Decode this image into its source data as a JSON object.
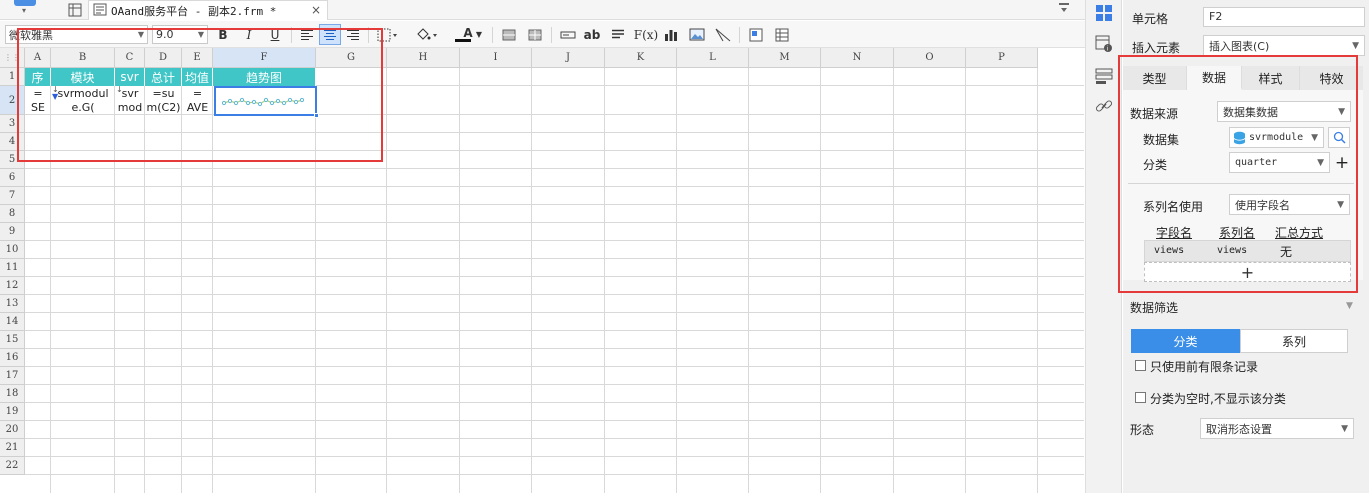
{
  "tabbar": {
    "doc_tab_title": "OAand服务平台 - 副本2.frm *",
    "close_glyph": "×",
    "menu_glyph": "▾"
  },
  "toolbar": {
    "font_family": "微软雅黑",
    "font_size": "9.0",
    "bold": "B",
    "italic": "I",
    "underline": "U",
    "ab_label": "ab",
    "fx_label": "F(x)",
    "font_color": "A"
  },
  "grid": {
    "corner_glyph": "⋮⋮",
    "columns": [
      "A",
      "B",
      "C",
      "D",
      "E",
      "F",
      "G",
      "H",
      "I",
      "J",
      "K",
      "L",
      "M",
      "N",
      "O",
      "P"
    ],
    "rows": [
      "1",
      "2",
      "3",
      "4",
      "5",
      "6",
      "7",
      "8",
      "9",
      "10",
      "11",
      "12",
      "13",
      "14",
      "15",
      "16",
      "17",
      "18",
      "19",
      "20",
      "21",
      "22"
    ],
    "header_row": [
      "序",
      "模块",
      "svr",
      "总计",
      "均值",
      "趋势图"
    ],
    "data_row": [
      "=\nSE",
      "svrmodul\ne.G(",
      "svr\nmod",
      "=su\nm(C2)",
      "=\nAVE",
      ""
    ],
    "selected_cell": "F2",
    "accent": "#40c6c6"
  },
  "panel": {
    "cell_label": "单元格",
    "cell_value": "F2",
    "insert_label": "插入元素",
    "insert_value": "插入图表(C)",
    "tabs": [
      "类型",
      "数据",
      "样式",
      "特效"
    ],
    "active_tab": "数据",
    "source_label": "数据来源",
    "source_value": "数据集数据",
    "dataset_label": "数据集",
    "dataset_value": "svrmodule",
    "category_label": "分类",
    "category_value": "quarter",
    "series_name_label": "系列名使用",
    "series_name_value": "使用字段名",
    "field_headers": [
      "字段名",
      "系列名",
      "汇总方式"
    ],
    "field_row": [
      "views",
      "views",
      "无"
    ],
    "add_glyph": "+",
    "filter_label": "数据筛选",
    "filter_toggle": [
      "分类",
      "系列"
    ],
    "filter_active": "分类",
    "opt_limit": "只使用前有限条记录",
    "opt_hide_empty": "分类为空时,不显示该分类",
    "shape_label": "形态",
    "shape_value": "取消形态设置"
  }
}
